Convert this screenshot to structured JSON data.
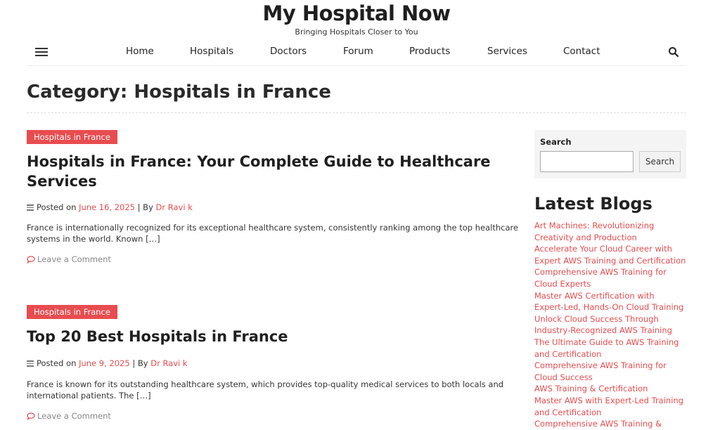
{
  "site": {
    "title": "My Hospital Now",
    "tagline": "Bringing Hospitals Closer to You"
  },
  "nav": {
    "items": [
      "Home",
      "Hospitals",
      "Doctors",
      "Forum",
      "Products",
      "Services",
      "Contact"
    ]
  },
  "category": {
    "title": "Category: Hospitals in France"
  },
  "posts": [
    {
      "tag": "Hospitals in France",
      "title": "Hospitals in France: Your Complete Guide to Healthcare Services",
      "posted_on_label": "Posted on",
      "date": "June 16, 2025",
      "by_label": "|  By",
      "author": "Dr Ravi k",
      "excerpt": "France is internationally recognized for its exceptional healthcare system, consistently ranking among the top healthcare systems in the world. Known […]",
      "comment_label": "Leave a Comment"
    },
    {
      "tag": "Hospitals in France",
      "title": "Top 20 Best Hospitals in France",
      "posted_on_label": "Posted on",
      "date": "June 9, 2025",
      "by_label": "|  By",
      "author": "Dr Ravi k",
      "excerpt": "France is known for its outstanding healthcare system, which provides top-quality medical services to both locals and international patients. The […]",
      "comment_label": "Leave a Comment"
    }
  ],
  "sidebar": {
    "search": {
      "label": "Search",
      "value": "",
      "button_label": "Search"
    },
    "latest": {
      "title": "Latest Blogs",
      "items": [
        "Art Machines: Revolutionizing Creativity and Production",
        "Accelerate Your Cloud Career with Expert AWS Training and Certification",
        "Comprehensive AWS Training for Cloud Experts",
        "Master AWS Certification with Expert-Led, Hands-On Cloud Training",
        "Unlock Cloud Success Through Industry-Recognized AWS Training",
        "The Ultimate Guide to AWS Training and Certification",
        "Comprehensive AWS Training for Cloud Success",
        "AWS Training & Certification",
        "Master AWS with Expert-Led Training and Certification",
        "Comprehensive AWS Training &"
      ]
    }
  },
  "colors": {
    "accent": "#e84c4f",
    "text": "#222222"
  }
}
